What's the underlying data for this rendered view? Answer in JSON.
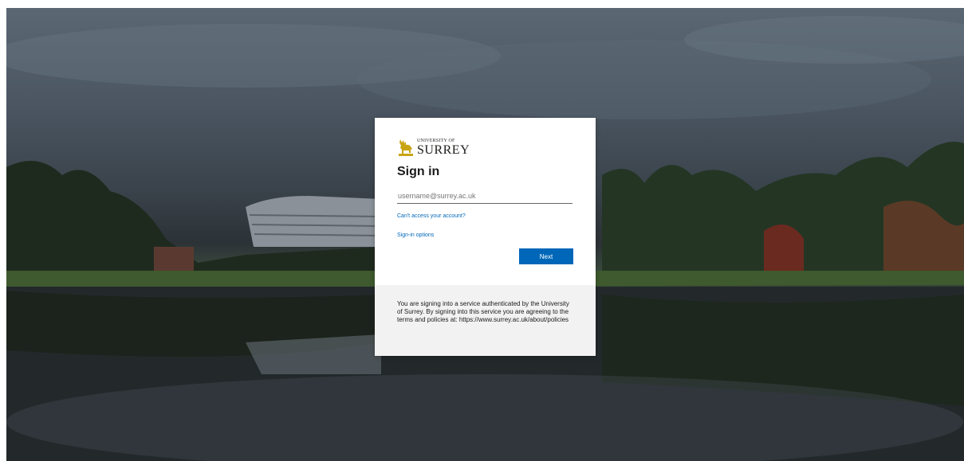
{
  "brand": {
    "logo_small": "UNIVERSITY OF",
    "logo_main": "SURREY",
    "logo_icon": "stag-icon",
    "logo_color": "#c8a415"
  },
  "signin": {
    "title": "Sign in",
    "email_placeholder": "username@surrey.ac.uk",
    "email_value": "",
    "cant_access_link": "Can't access your account?",
    "signin_options_link": "Sign-in options",
    "next_button": "Next"
  },
  "notice": {
    "text": "You are signing into a service authenticated by the University of Surrey. By signing into this service you are agreeing to the terms and policies at: https://www.surrey.ac.uk/about/policies"
  },
  "colors": {
    "accent": "#0067b8",
    "card_footer_bg": "#f2f2f2"
  }
}
